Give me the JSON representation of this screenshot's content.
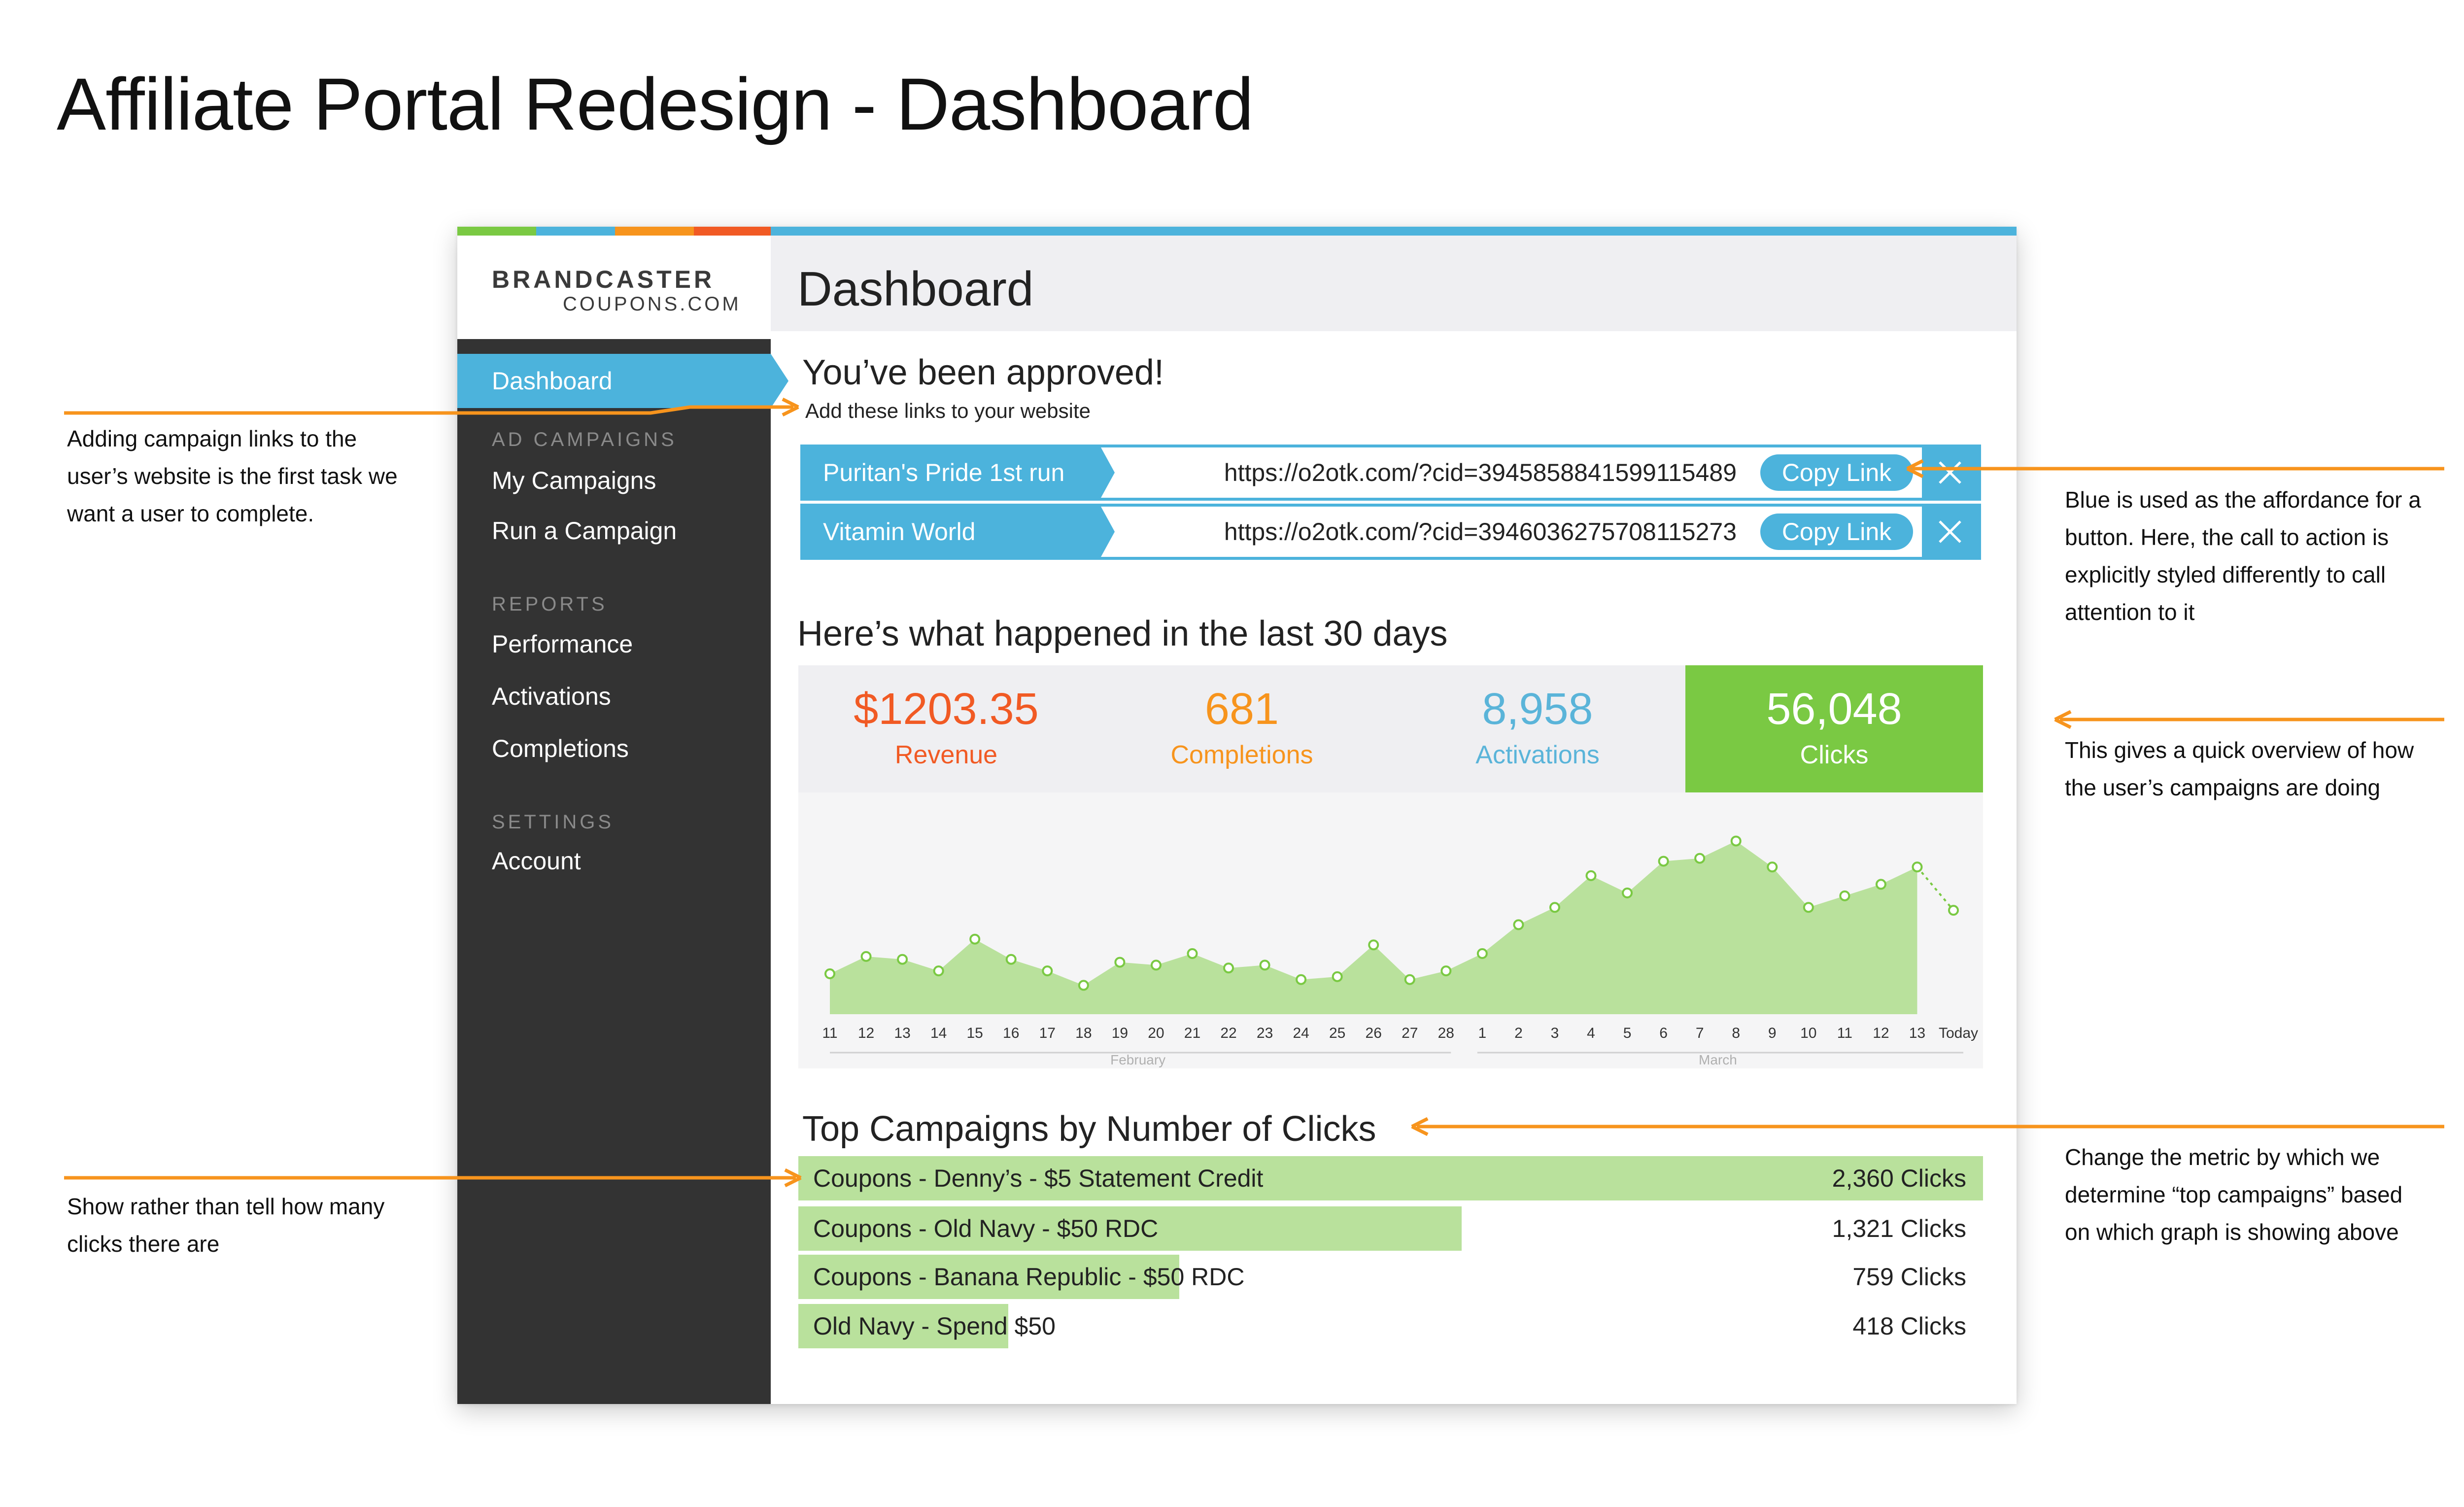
{
  "title": "Affiliate Portal Redesign - Dashboard",
  "colors": {
    "blue": "#4cb3dc",
    "green": "#7ac943",
    "light_green": "#b9e19c",
    "orange": "#f7941d",
    "revenue_red": "#f15a24",
    "activations_blue": "#5ab4d9",
    "sidebar": "#333333",
    "strip": [
      "#7ac943",
      "#4cb3dc",
      "#f7941d",
      "#f15a24"
    ]
  },
  "logo": {
    "main": "BRANDCASTER",
    "sub": "COUPONS.COM"
  },
  "sidebar": {
    "active": "Dashboard",
    "sections": [
      {
        "label": "AD CAMPAIGNS",
        "items": [
          "My Campaigns",
          "Run a Campaign"
        ]
      },
      {
        "label": "REPORTS",
        "items": [
          "Performance",
          "Activations",
          "Completions"
        ]
      },
      {
        "label": "SETTINGS",
        "items": [
          "Account"
        ]
      }
    ]
  },
  "main": {
    "header": "Dashboard",
    "approved": {
      "title": "You’ve been approved!",
      "subtitle": "Add these links to your website",
      "links": [
        {
          "name": "Puritan's Pride 1st run",
          "url": "https://o2otk.com/?cid=3945858841599115489",
          "button": "Copy Link",
          "close_icon": "close-icon"
        },
        {
          "name": "Vitamin World",
          "url": "https://o2otk.com/?cid=3946036275708115273",
          "button": "Copy Link",
          "close_icon": "close-icon"
        }
      ]
    },
    "last30": {
      "title": "Here’s what happened in the last 30 days",
      "stats": [
        {
          "value": "$1203.35",
          "label": "Revenue",
          "color": "#f15a24"
        },
        {
          "value": "681",
          "label": "Completions",
          "color": "#f7941d"
        },
        {
          "value": "8,958",
          "label": "Activations",
          "color": "#5ab4d9"
        },
        {
          "value": "56,048",
          "label": "Clicks",
          "color": "#ffffff",
          "selected": true
        }
      ]
    },
    "top_campaigns": {
      "title": "Top Campaigns by Number of Clicks",
      "items": [
        {
          "name": "Coupons - Denny’s - $5 Statement Credit",
          "value": "2,360 Clicks",
          "clicks": 2360
        },
        {
          "name": "Coupons - Old Navy - $50 RDC",
          "value": "1,321 Clicks",
          "clicks": 1321
        },
        {
          "name": "Coupons - Banana Republic - $50 RDC",
          "value": "759 Clicks",
          "clicks": 759
        },
        {
          "name": "Old Navy - Spend $50",
          "value": "418 Clicks",
          "clicks": 418
        }
      ]
    }
  },
  "chart_data": {
    "type": "area",
    "x": [
      "11",
      "12",
      "13",
      "14",
      "15",
      "16",
      "17",
      "18",
      "19",
      "20",
      "21",
      "22",
      "23",
      "24",
      "25",
      "26",
      "27",
      "28",
      "1",
      "2",
      "3",
      "4",
      "5",
      "6",
      "7",
      "8",
      "9",
      "10",
      "11",
      "12",
      "13",
      "Today"
    ],
    "months": [
      "February",
      "March"
    ],
    "series": [
      {
        "values": [
          14,
          20,
          19,
          15,
          26,
          19,
          15,
          10,
          18,
          17,
          21,
          16,
          17,
          12,
          13,
          24,
          12,
          15,
          21,
          31,
          37,
          48,
          42,
          53,
          54,
          60,
          51,
          37,
          41,
          45,
          51,
          36
        ]
      }
    ],
    "last_point_projected": true,
    "ylim": [
      0,
      70
    ]
  },
  "annotations": [
    {
      "lines": [
        "Adding campaign links to the",
        "user’s website is the first task we",
        "want a user to complete."
      ]
    },
    {
      "lines": [
        "Show rather than tell how many",
        "clicks there are"
      ]
    },
    {
      "lines": [
        "Blue is used as the affordance for a",
        "button.  Here, the call to action is",
        "explicitly styled differently to call",
        "attention to it"
      ]
    },
    {
      "lines": [
        "This gives a quick overview of how",
        "the user’s campaigns are doing"
      ]
    },
    {
      "lines": [
        "Change the metric by which we",
        "determine “top campaigns” based",
        "on which graph is showing above"
      ]
    }
  ]
}
